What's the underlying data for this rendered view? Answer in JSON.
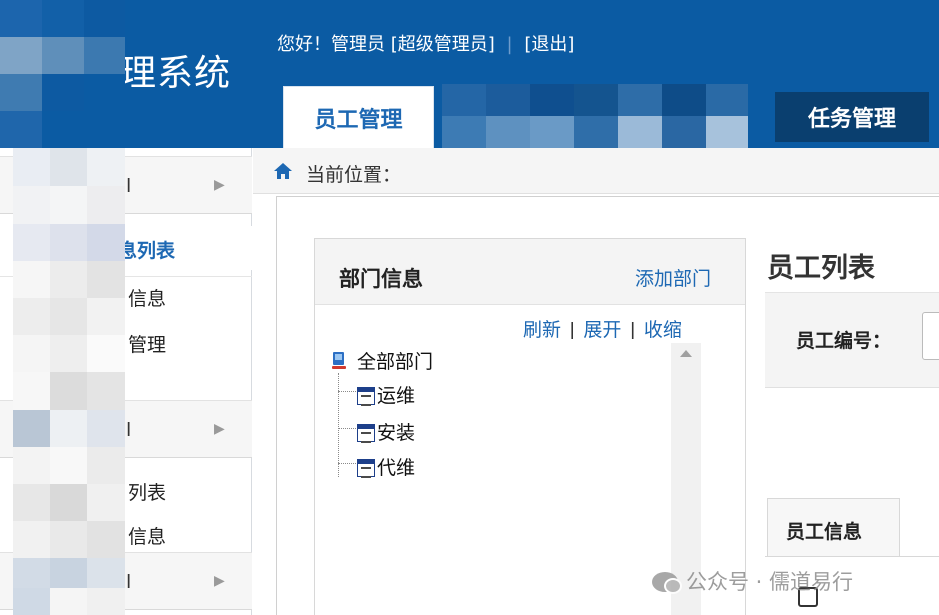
{
  "header": {
    "app_title": "理系统",
    "greeting": "您好！管理员",
    "role": "[超级管理员]",
    "logout": "[退出]",
    "tabs": [
      {
        "label": "员工管理",
        "active": true
      },
      {
        "label": "任务管理",
        "active": false
      }
    ]
  },
  "sidebar": {
    "groups": [
      {
        "label": "l"
      },
      {
        "label": "l"
      },
      {
        "label": "l"
      }
    ],
    "items": [
      {
        "label": "息列表",
        "active": true
      },
      {
        "label": "信息"
      },
      {
        "label": "管理"
      },
      {
        "label": "列表"
      },
      {
        "label": "信息"
      }
    ]
  },
  "location": {
    "label": "当前位置："
  },
  "department_panel": {
    "title": "部门信息",
    "add_link": "添加部门",
    "actions": [
      "刷新",
      "展开",
      "收缩"
    ],
    "tree": {
      "root": "全部部门",
      "children": [
        "运维",
        "安装",
        "代维"
      ]
    }
  },
  "employee_list": {
    "title": "员工列表",
    "filter_label": "员工编号：",
    "info_tab": "员工信息"
  },
  "watermark": {
    "text": "公众号 · 儒道易行"
  },
  "colors": {
    "header_bg": "#0b5ba3",
    "accent": "#1d68b3",
    "task_tab_bg": "#0a3f6f"
  }
}
